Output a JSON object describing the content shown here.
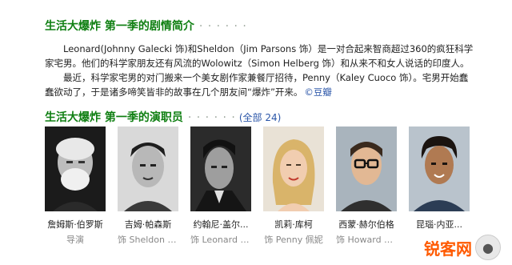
{
  "synopsis_section": {
    "title": "生活大爆炸 第一季的剧情简介",
    "dots": "· · · · · ·",
    "paragraph1": "Leonard(Johnny Galecki 饰)和Sheldon（Jim Parsons 饰）是一对合起来智商超过360的疯狂科学家宅男。他们的科学家朋友还有风流的Wolowitz（Simon Helberg 饰）和从来不和女人说话的印度人。",
    "paragraph2": "最近，科学家宅男的对门搬来一个美女剧作家兼餐厅招待，Penny（Kaley Cuoco 饰）。宅男开始蠢蠢欲动了，于是诸多啼笑皆非的故事在几个朋友间“爆炸”开来。",
    "source_link": "©豆瓣"
  },
  "cast_section": {
    "title": "生活大爆炸 第一季的演职员",
    "dots": "· · · · · ·",
    "count": "(全部 24)"
  },
  "cast": [
    {
      "name": "詹姆斯·伯罗斯",
      "role": "导演"
    },
    {
      "name": "吉姆·帕森斯",
      "role": "饰 Sheldon C..."
    },
    {
      "name": "约翰尼·盖尔...",
      "role": "饰 Leonard H..."
    },
    {
      "name": "凯莉·库柯",
      "role": "饰 Penny 佩妮"
    },
    {
      "name": "西蒙·赫尔伯格",
      "role": "饰 Howard W..."
    },
    {
      "name": "昆瑙·内亚...",
      "role": ""
    }
  ],
  "watermark": {
    "text": "锐客网",
    "icon": "wechat-icon"
  },
  "colors": {
    "title_green": "#0f7f12",
    "link_blue": "#2a55a8",
    "watermark_orange": "#ff5a00"
  }
}
